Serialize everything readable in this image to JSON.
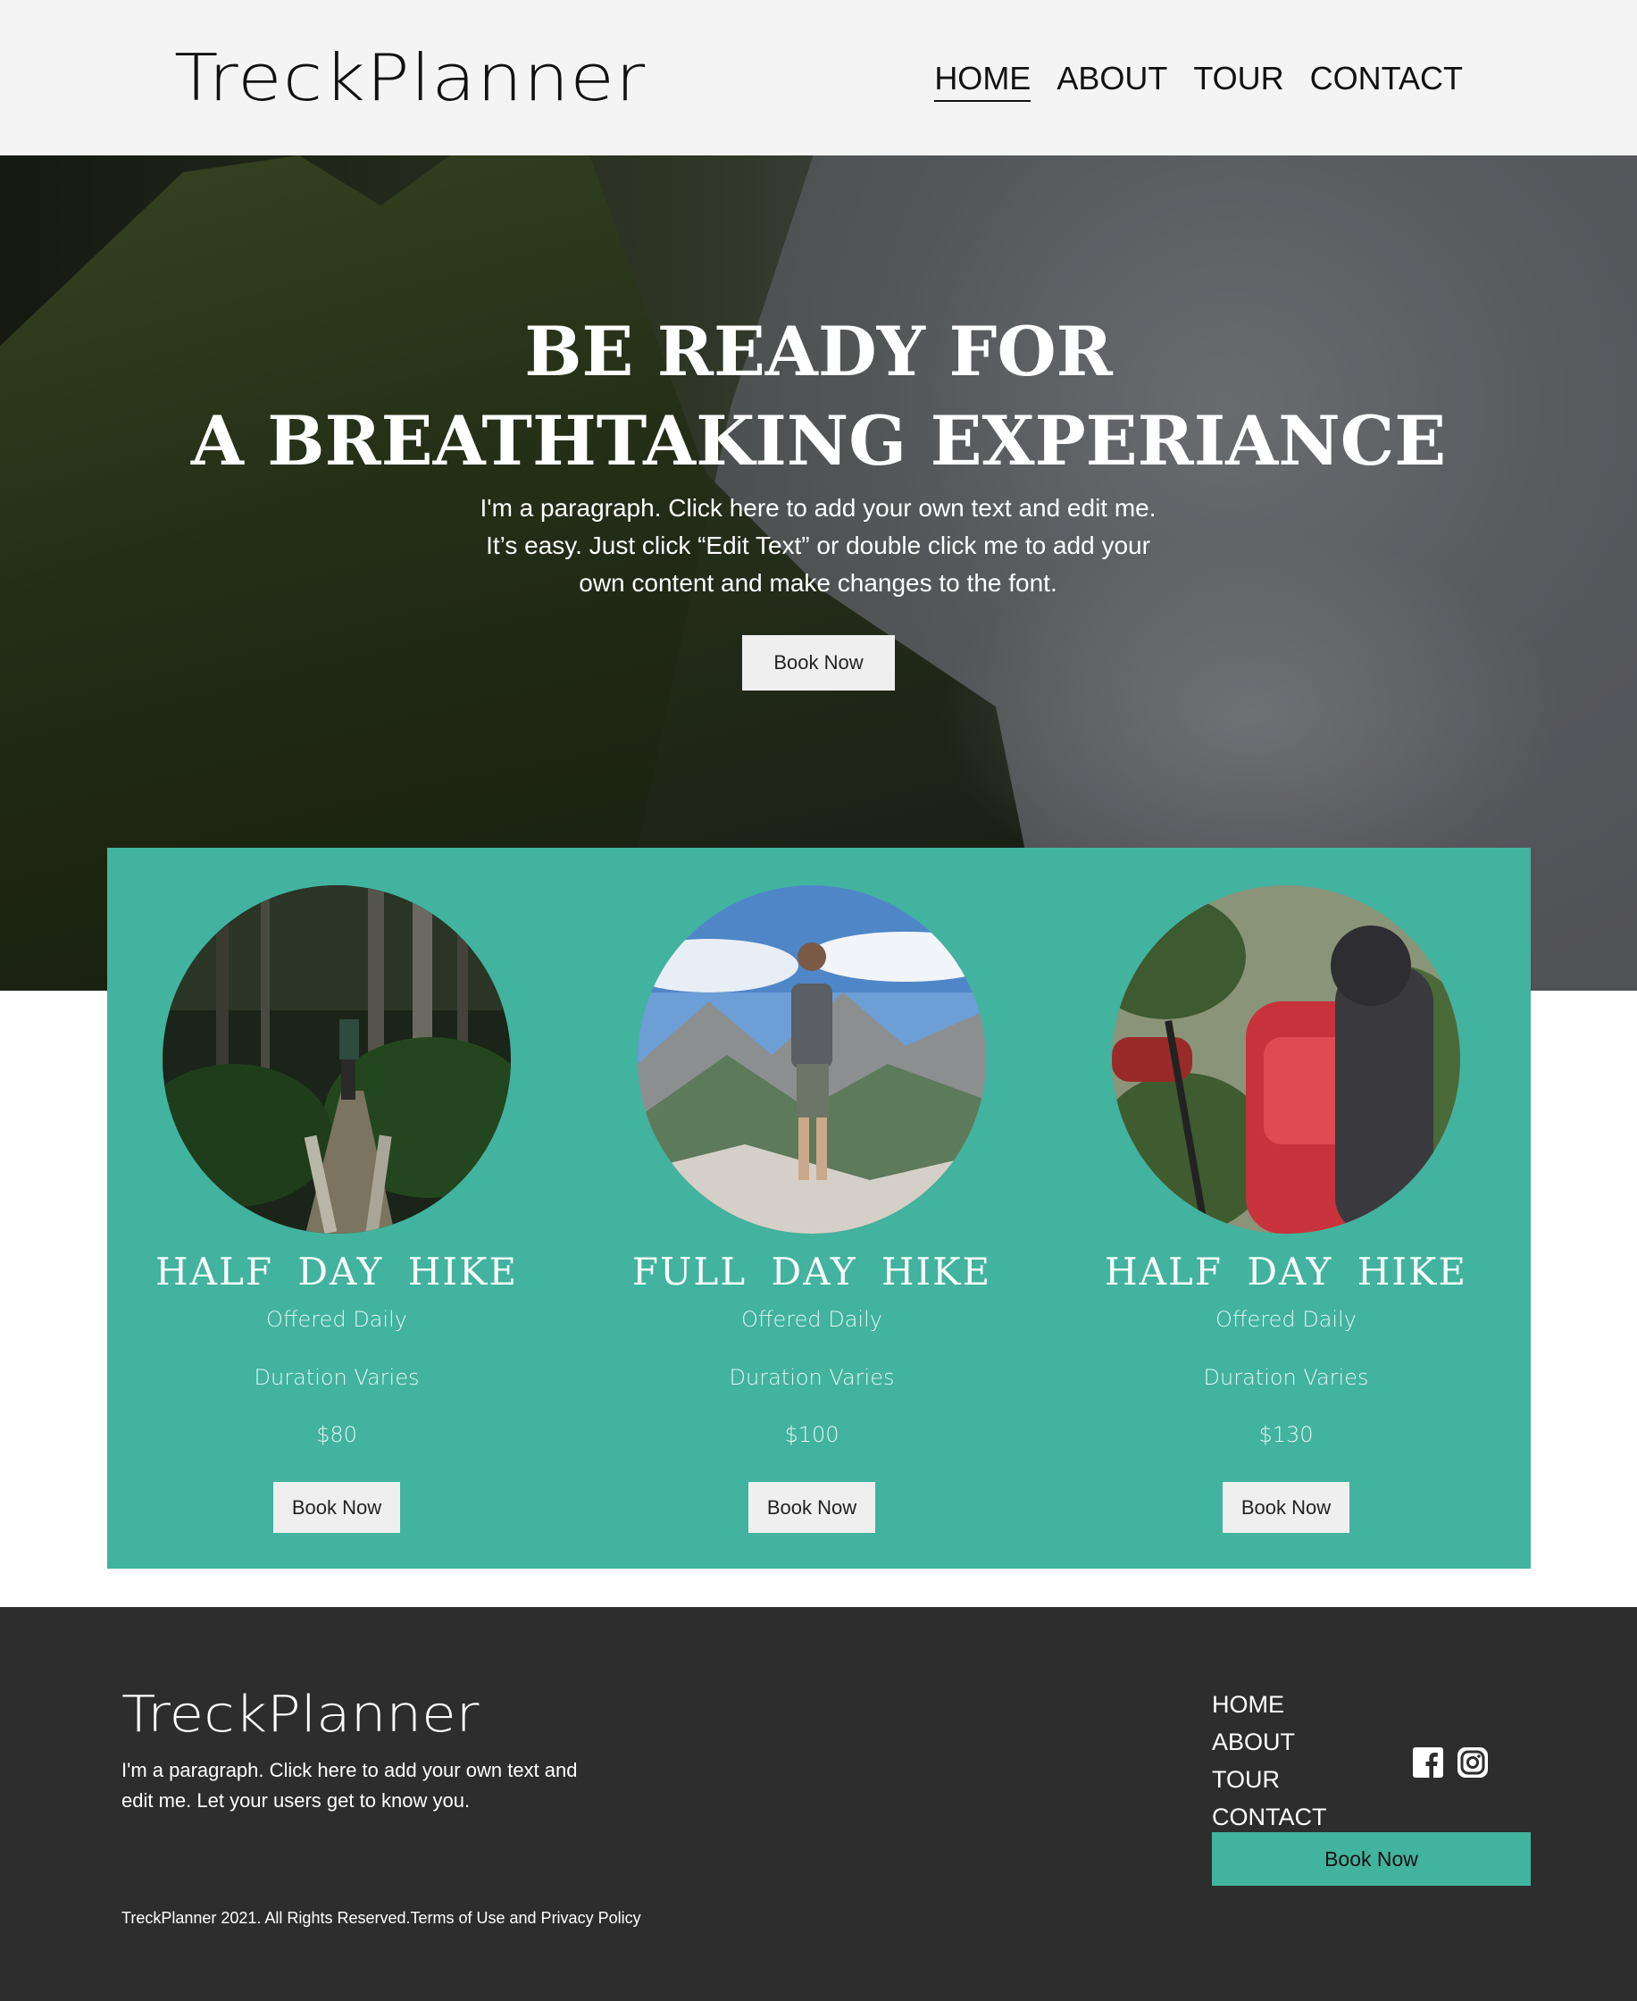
{
  "header": {
    "logo": "TreckPlanner",
    "nav": [
      "HOME",
      "ABOUT",
      "TOUR",
      "CONTACT"
    ]
  },
  "hero": {
    "title_line1": "BE READY FOR",
    "title_line2": "A BREATHTAKING EXPERIANCE",
    "paragraph_line1": "I'm a paragraph. Click here to add your own text and edit me.",
    "paragraph_line2": "It’s easy. Just click “Edit Text” or double click me to add your",
    "paragraph_line3": "own content and make changes to the font.",
    "button": "Book Now"
  },
  "cards": [
    {
      "title": "HALF DAY HIKE",
      "schedule": "Offered Daily",
      "duration": "Duration Varies",
      "price": "$80",
      "button": "Book Now"
    },
    {
      "title": "FULL DAY HIKE",
      "schedule": "Offered Daily",
      "duration": "Duration Varies",
      "price": "$100",
      "button": "Book Now"
    },
    {
      "title": "HALF DAY HIKE",
      "schedule": "Offered Daily",
      "duration": "Duration Varies",
      "price": "$130",
      "button": "Book Now"
    }
  ],
  "footer": {
    "logo": "TreckPlanner",
    "paragraph_line1": "I'm a paragraph. Click here to add your own text and",
    "paragraph_line2": "edit me. Let your users get to know you.",
    "nav": [
      "HOME",
      "ABOUT",
      "TOUR",
      "CONTACT"
    ],
    "social_icons": [
      "facebook-icon",
      "instagram-icon"
    ],
    "button": "Book Now",
    "copyright": "TreckPlanner 2021. All Rights Reserved.",
    "terms_link": "Terms of Use and Privacy Policy"
  },
  "colors": {
    "accent": "#41b39f",
    "footer_bg": "#2d2d2d",
    "header_bg": "#f4f4f4"
  }
}
